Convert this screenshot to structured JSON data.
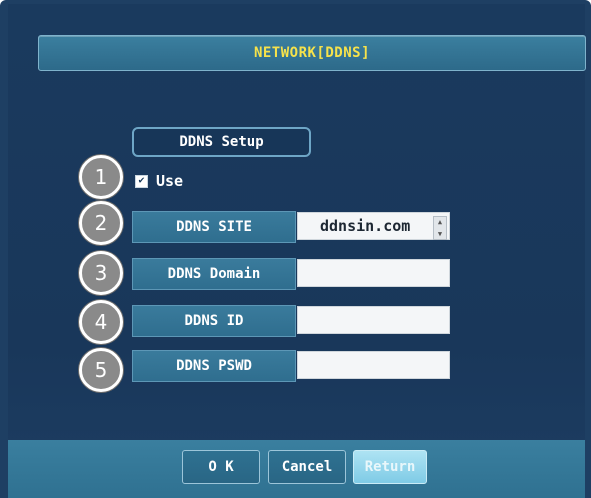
{
  "screen": {
    "title": "NETWORK[DDNS]"
  },
  "section": {
    "label": "DDNS Setup"
  },
  "use": {
    "label": "Use",
    "checked": true,
    "check_glyph": "✔"
  },
  "badges": [
    "1",
    "2",
    "3",
    "4",
    "5"
  ],
  "fields": [
    {
      "label": "DDNS SITE",
      "value": "ddnsin.com",
      "has_spinner": true
    },
    {
      "label": "DDNS Domain",
      "value": ""
    },
    {
      "label": "DDNS ID",
      "value": ""
    },
    {
      "label": "DDNS PSWD",
      "value": ""
    }
  ],
  "buttons": {
    "ok": "O K",
    "cancel": "Cancel",
    "return": "Return"
  },
  "spinner": {
    "up": "▲",
    "down": "▼"
  },
  "colors": {
    "title_text": "#f6e24b",
    "background": "#1a3a5e",
    "accent": "#3a7b9c"
  }
}
